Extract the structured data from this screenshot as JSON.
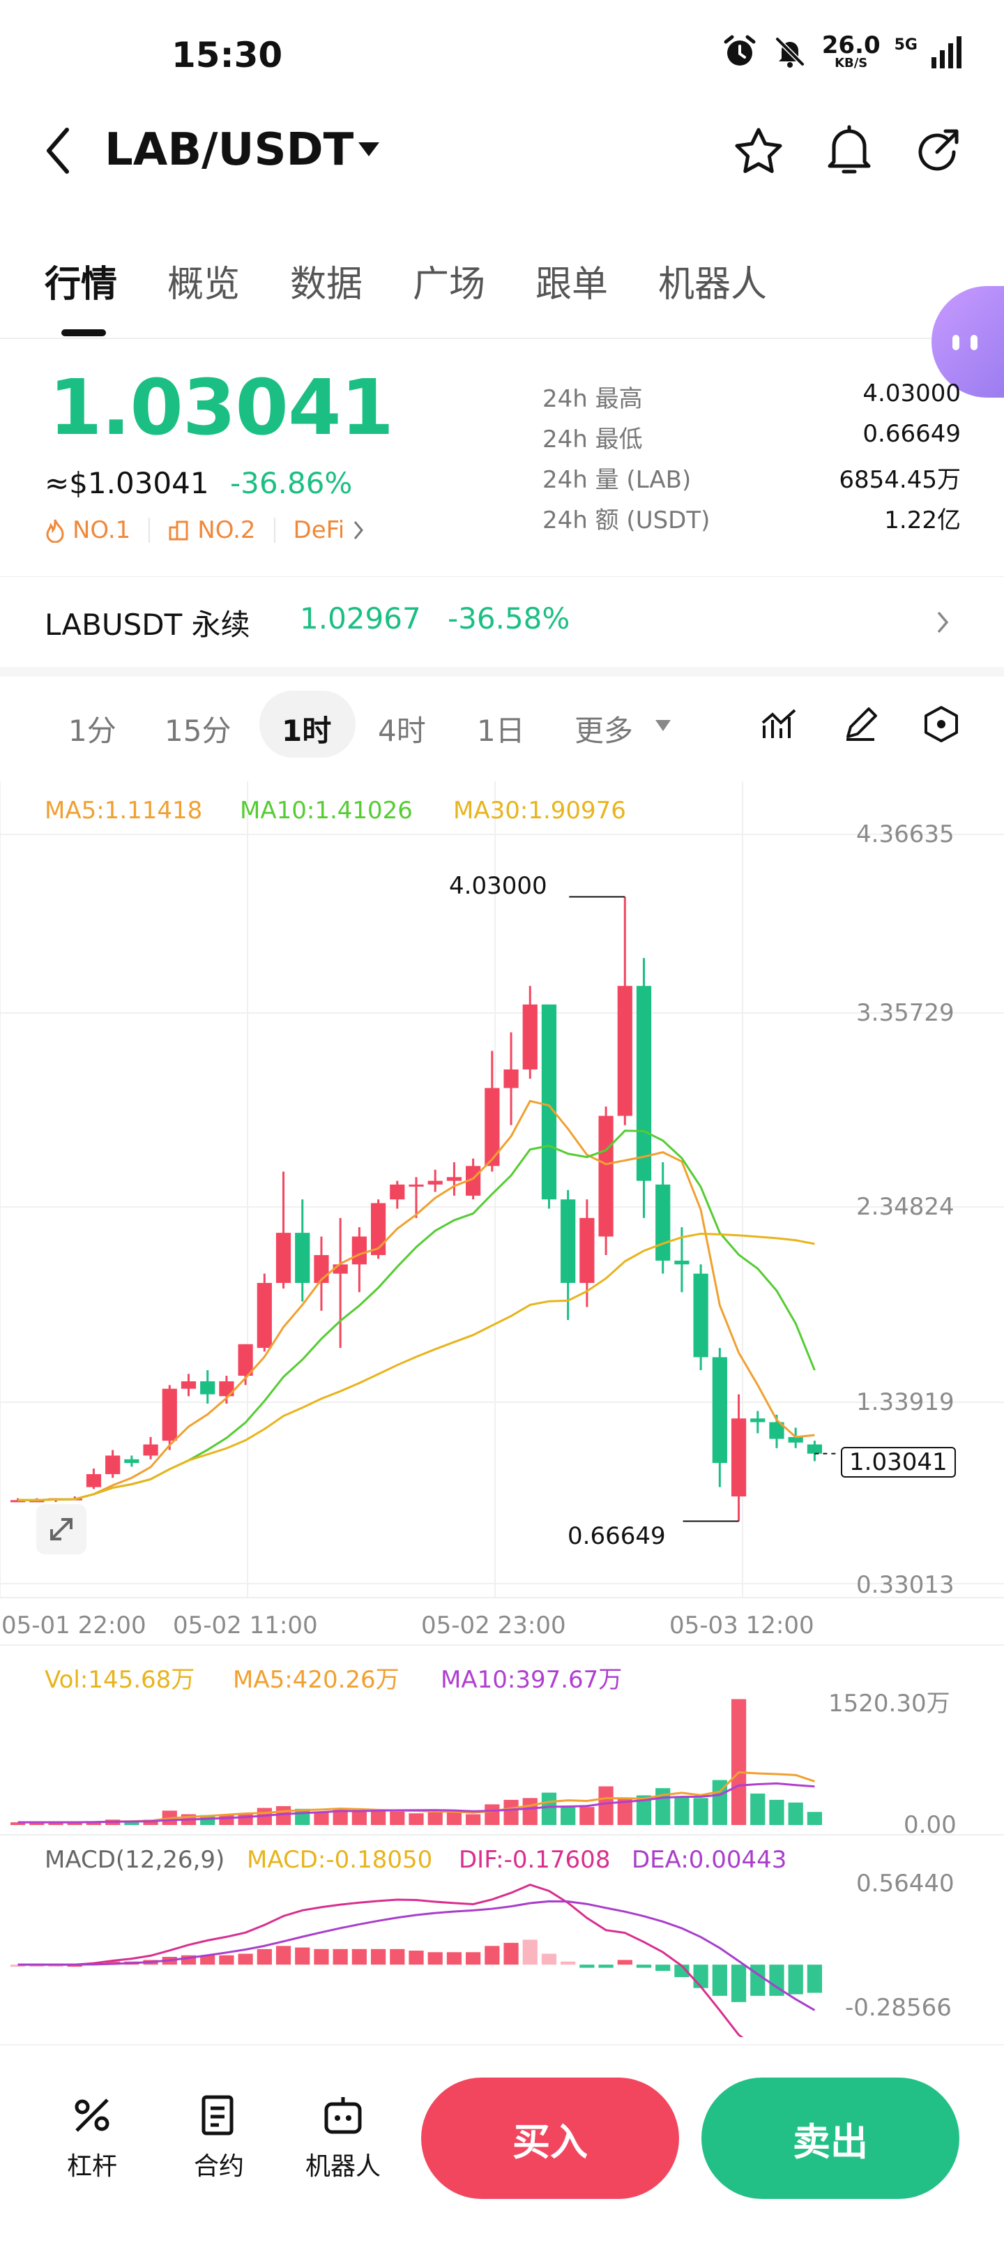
{
  "status_bar": {
    "time": "15:30",
    "speed_value": "26.0",
    "speed_unit": "KB/S",
    "network": "5G"
  },
  "header": {
    "pair": "LAB/USDT"
  },
  "tabs": [
    "行情",
    "概览",
    "数据",
    "广场",
    "跟单",
    "机器人"
  ],
  "ticker": {
    "price": "1.03041",
    "usd_price": "≈$1.03041",
    "change": "-36.86%",
    "badges": [
      "NO.1",
      "NO.2",
      "DeFi"
    ]
  },
  "stats": [
    {
      "label": "24h  最高",
      "value": "4.03000"
    },
    {
      "label": "24h  最低",
      "value": "0.66649"
    },
    {
      "label": "24h  量 (LAB)",
      "value": "6854.45万"
    },
    {
      "label": "24h  额 (USDT)",
      "value": "1.22亿"
    }
  ],
  "perpetual": {
    "name": "LABUSDT 永续",
    "price": "1.02967",
    "change": "-36.58%"
  },
  "intervals": [
    "1分",
    "15分",
    "1时",
    "4时",
    "1日",
    "更多"
  ],
  "active_interval": "1时",
  "indicators": {
    "ma5": "MA5:1.11418",
    "ma10": "MA10:1.41026",
    "ma30": "MA30:1.90976",
    "vol": "Vol:145.68万",
    "vol_ma5": "MA5:420.26万",
    "vol_ma10": "MA10:397.67万",
    "macd_title": "MACD(12,26,9)",
    "macd": "MACD:-0.18050",
    "dif": "DIF:-0.17608",
    "dea": "DEA:0.00443"
  },
  "colors": {
    "up": "#f2465f",
    "down": "#1bbf83",
    "ma5": "#f0a030",
    "ma10": "#55cc33",
    "ma30": "#e8b41c",
    "vol_ma10": "#b03fd0",
    "dif": "#d82f8f",
    "dea": "#a93ecb"
  },
  "chart_data": {
    "type": "candlestick",
    "price_axis_ticks": [
      "4.36635",
      "3.35729",
      "2.34824",
      "1.33919",
      "0.33013"
    ],
    "time_labels": [
      "05-01 22:00",
      "05-02 11:00",
      "05-02 23:00",
      "05-03 12:00"
    ],
    "high_label": "4.03000",
    "low_label": "0.66649",
    "current_price_label": "1.03041",
    "ylim": [
      0.33013,
      4.36635
    ],
    "candles": [
      {
        "o": 0.78,
        "h": 0.79,
        "l": 0.77,
        "c": 0.78
      },
      {
        "o": 0.78,
        "h": 0.79,
        "l": 0.77,
        "c": 0.78
      },
      {
        "o": 0.78,
        "h": 0.79,
        "l": 0.77,
        "c": 0.79
      },
      {
        "o": 0.79,
        "h": 0.8,
        "l": 0.78,
        "c": 0.79
      },
      {
        "o": 0.85,
        "h": 0.95,
        "l": 0.84,
        "c": 0.92
      },
      {
        "o": 0.92,
        "h": 1.05,
        "l": 0.9,
        "c": 1.02
      },
      {
        "o": 1.0,
        "h": 1.02,
        "l": 0.96,
        "c": 0.98
      },
      {
        "o": 1.02,
        "h": 1.12,
        "l": 1.0,
        "c": 1.08
      },
      {
        "o": 1.1,
        "h": 1.4,
        "l": 1.05,
        "c": 1.38
      },
      {
        "o": 1.38,
        "h": 1.46,
        "l": 1.34,
        "c": 1.42
      },
      {
        "o": 1.42,
        "h": 1.48,
        "l": 1.3,
        "c": 1.35
      },
      {
        "o": 1.34,
        "h": 1.45,
        "l": 1.3,
        "c": 1.42
      },
      {
        "o": 1.45,
        "h": 1.62,
        "l": 1.4,
        "c": 1.62
      },
      {
        "o": 1.6,
        "h": 2.0,
        "l": 1.58,
        "c": 1.95
      },
      {
        "o": 1.95,
        "h": 2.55,
        "l": 1.92,
        "c": 2.22
      },
      {
        "o": 2.22,
        "h": 2.4,
        "l": 1.85,
        "c": 1.95
      },
      {
        "o": 1.95,
        "h": 2.2,
        "l": 1.8,
        "c": 2.1
      },
      {
        "o": 2.0,
        "h": 2.3,
        "l": 1.6,
        "c": 2.05
      },
      {
        "o": 2.05,
        "h": 2.25,
        "l": 1.9,
        "c": 2.2
      },
      {
        "o": 2.1,
        "h": 2.4,
        "l": 2.08,
        "c": 2.38
      },
      {
        "o": 2.4,
        "h": 2.5,
        "l": 2.35,
        "c": 2.48
      },
      {
        "o": 2.48,
        "h": 2.52,
        "l": 2.3,
        "c": 2.48
      },
      {
        "o": 2.48,
        "h": 2.56,
        "l": 2.44,
        "c": 2.5
      },
      {
        "o": 2.5,
        "h": 2.6,
        "l": 2.42,
        "c": 2.52
      },
      {
        "o": 2.42,
        "h": 2.62,
        "l": 2.4,
        "c": 2.58
      },
      {
        "o": 2.58,
        "h": 3.2,
        "l": 2.55,
        "c": 3.0
      },
      {
        "o": 3.0,
        "h": 3.3,
        "l": 2.8,
        "c": 3.1
      },
      {
        "o": 3.1,
        "h": 3.55,
        "l": 3.05,
        "c": 3.45
      },
      {
        "o": 3.45,
        "h": 3.45,
        "l": 2.35,
        "c": 2.4
      },
      {
        "o": 2.4,
        "h": 2.45,
        "l": 1.75,
        "c": 1.95
      },
      {
        "o": 1.95,
        "h": 2.4,
        "l": 1.82,
        "c": 2.3
      },
      {
        "o": 2.2,
        "h": 2.9,
        "l": 2.1,
        "c": 2.85
      },
      {
        "o": 2.85,
        "h": 4.03,
        "l": 2.8,
        "c": 3.55
      },
      {
        "o": 3.55,
        "h": 3.7,
        "l": 2.3,
        "c": 2.5
      },
      {
        "o": 2.48,
        "h": 2.6,
        "l": 2.0,
        "c": 2.07
      },
      {
        "o": 2.07,
        "h": 2.25,
        "l": 1.9,
        "c": 2.05
      },
      {
        "o": 2.0,
        "h": 2.05,
        "l": 1.48,
        "c": 1.55
      },
      {
        "o": 1.55,
        "h": 1.6,
        "l": 0.85,
        "c": 0.98
      },
      {
        "o": 0.8,
        "h": 1.35,
        "l": 0.66649,
        "c": 1.22
      },
      {
        "o": 1.22,
        "h": 1.26,
        "l": 1.14,
        "c": 1.2
      },
      {
        "o": 1.2,
        "h": 1.24,
        "l": 1.06,
        "c": 1.11
      },
      {
        "o": 1.12,
        "h": 1.17,
        "l": 1.06,
        "c": 1.09
      },
      {
        "o": 1.08,
        "h": 1.1,
        "l": 0.99,
        "c": 1.03041
      }
    ],
    "volume_axis_ticks": [
      "1520.30万",
      "0.00"
    ],
    "volumes": [
      30,
      30,
      30,
      30,
      40,
      60,
      50,
      60,
      160,
      120,
      110,
      120,
      130,
      190,
      210,
      180,
      150,
      180,
      160,
      170,
      150,
      130,
      140,
      150,
      120,
      230,
      280,
      300,
      360,
      200,
      200,
      430,
      300,
      330,
      410,
      320,
      300,
      500,
      1400,
      350,
      280,
      250,
      145.68
    ],
    "macd_axis_ticks": [
      "0.56440",
      "-0.28566"
    ],
    "macd_hist": [
      0.0,
      0.0,
      0.0,
      0.0,
      0.01,
      0.02,
      0.02,
      0.03,
      0.05,
      0.06,
      0.06,
      0.06,
      0.07,
      0.1,
      0.12,
      0.11,
      0.1,
      0.1,
      0.1,
      0.1,
      0.1,
      0.09,
      0.08,
      0.08,
      0.08,
      0.12,
      0.14,
      0.16,
      0.07,
      0.02,
      -0.02,
      -0.02,
      0.03,
      -0.02,
      -0.04,
      -0.08,
      -0.15,
      -0.2,
      -0.24,
      -0.2,
      -0.2,
      -0.19,
      -0.1805
    ]
  }
}
